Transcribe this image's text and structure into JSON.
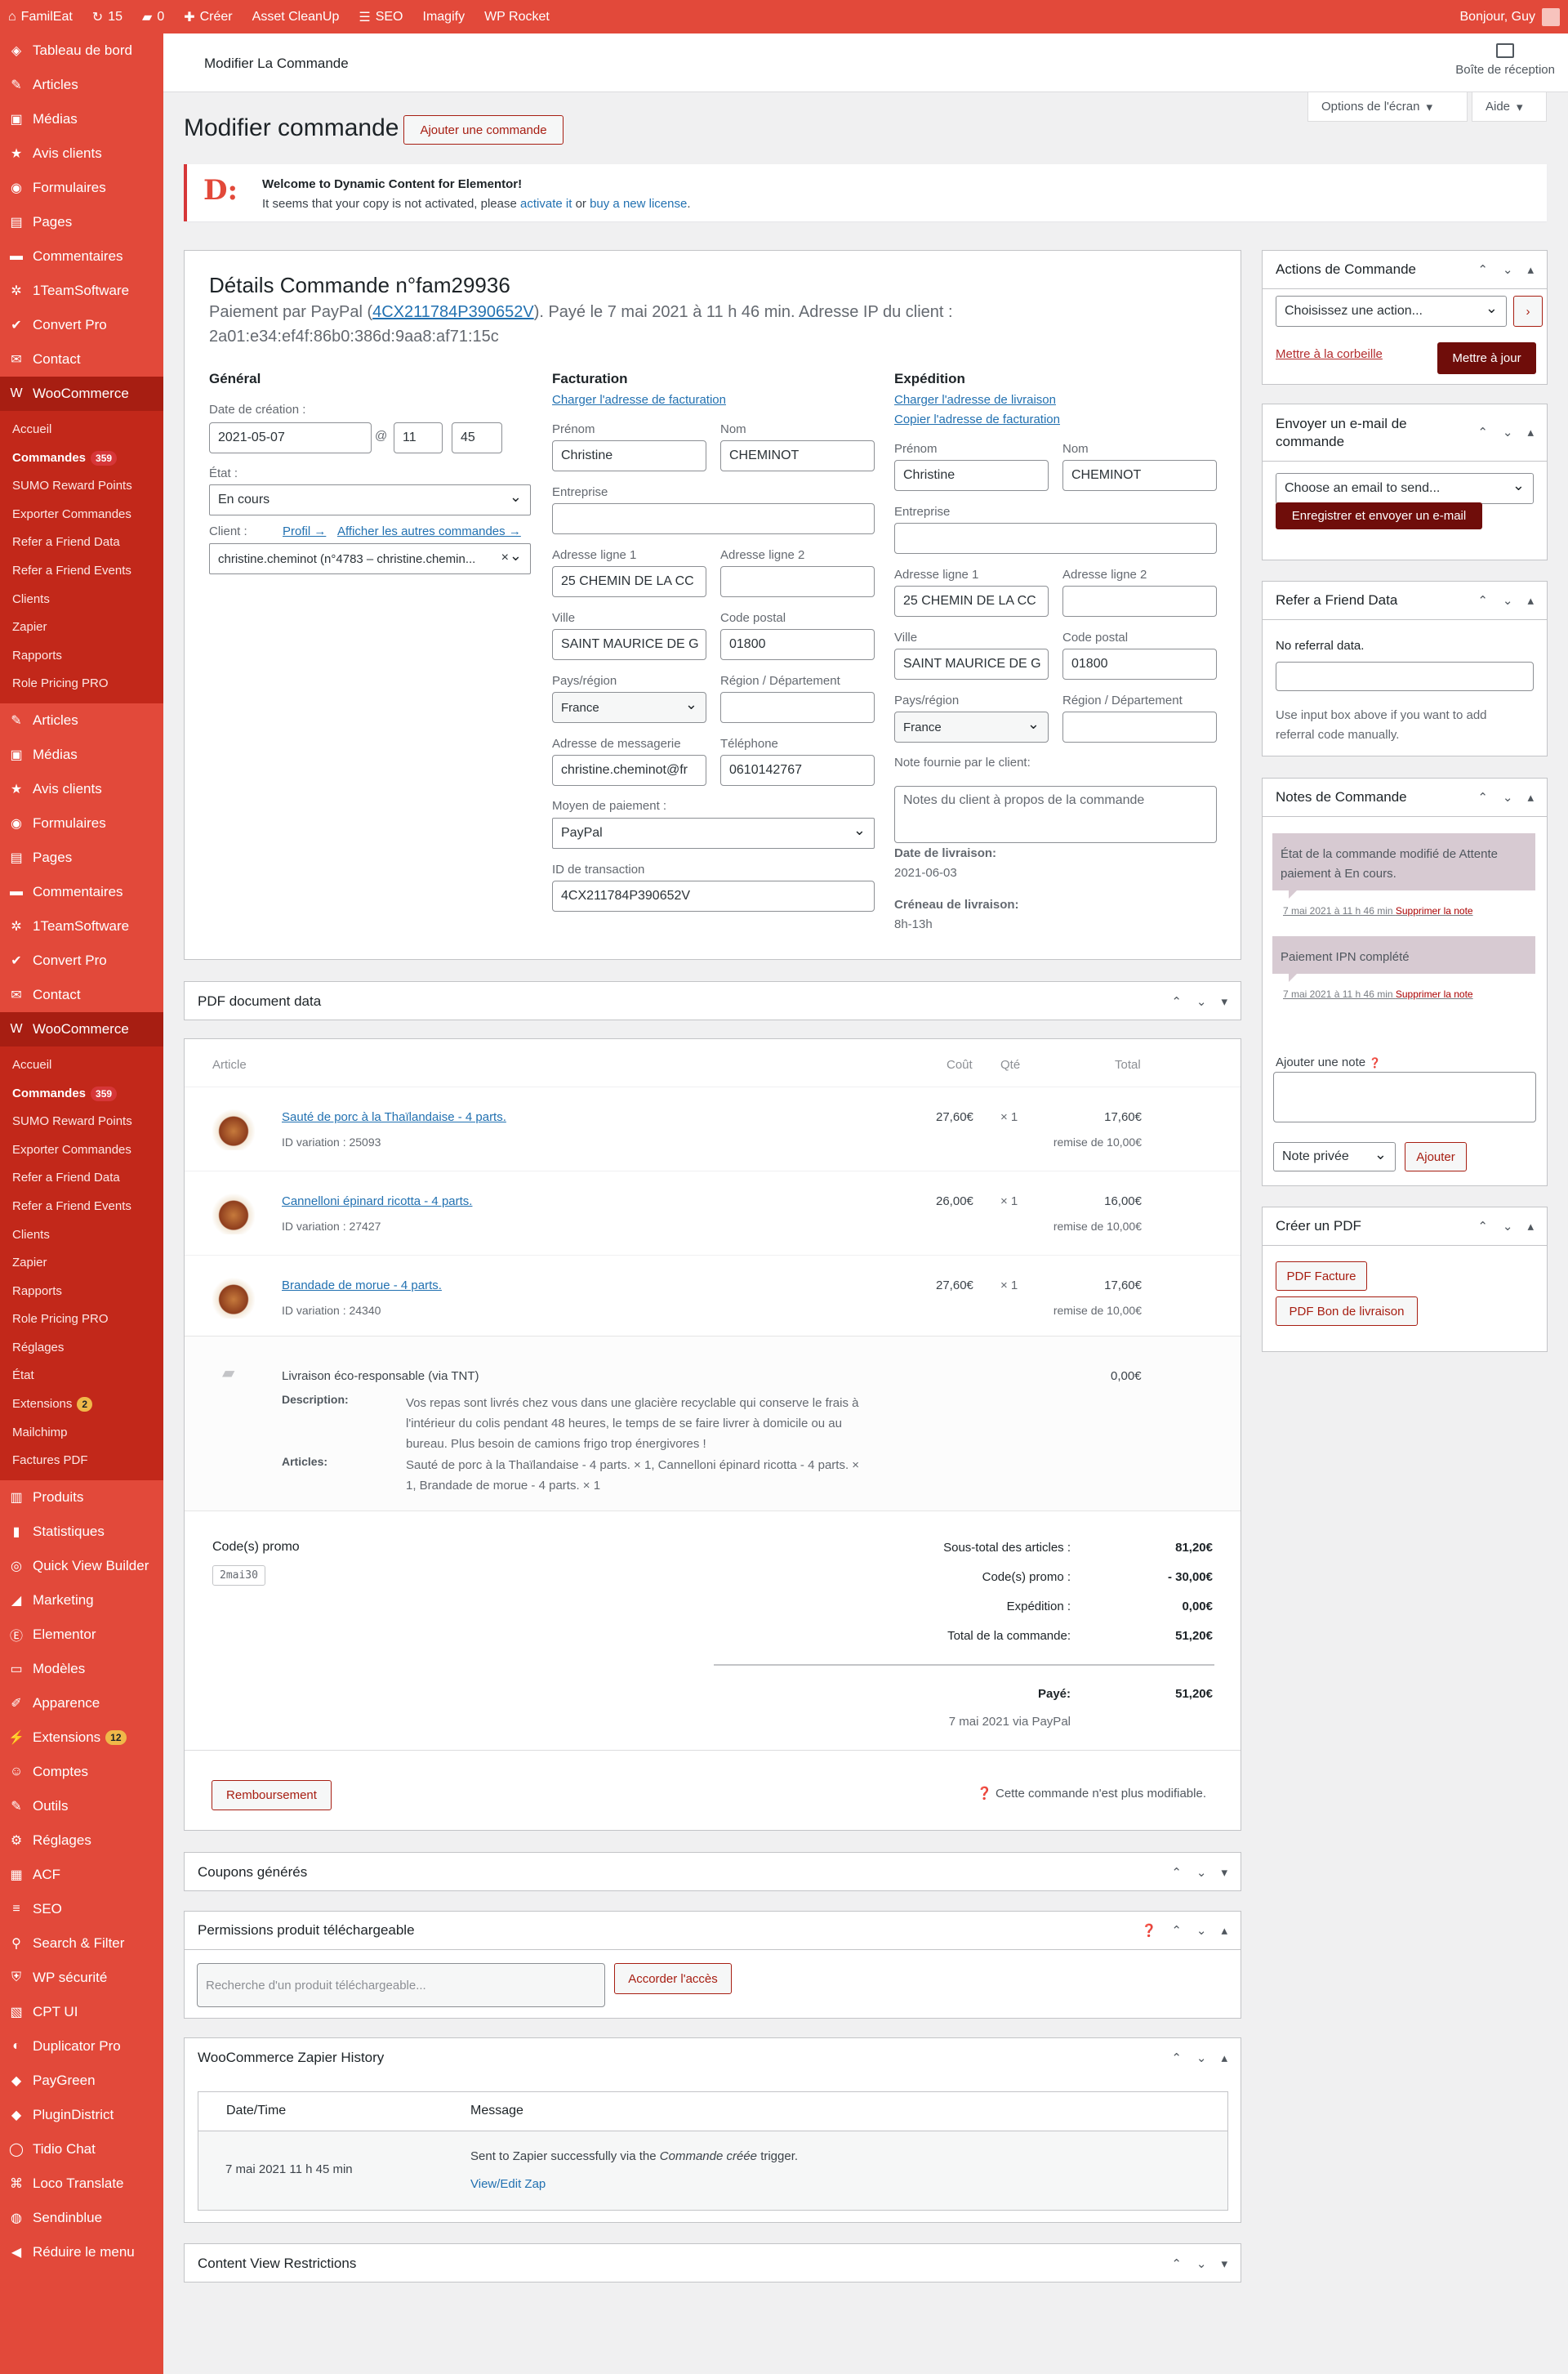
{
  "adminbar": {
    "site": "FamilEat",
    "updates": "15",
    "comments": "0",
    "new": "Créer",
    "asset": "Asset CleanUp",
    "seo": "SEO",
    "imagify": "Imagify",
    "rocket": "WP Rocket",
    "greeting": "Bonjour, Guy"
  },
  "sidebar": {
    "top": [
      {
        "icon": "dashboard-icon",
        "glyph": "◈",
        "label": "Tableau de bord"
      },
      {
        "icon": "pin-icon",
        "glyph": "✎",
        "label": "Articles"
      },
      {
        "icon": "media-icon",
        "glyph": "▣",
        "label": "Médias"
      },
      {
        "icon": "star-icon",
        "glyph": "★",
        "label": "Avis clients"
      },
      {
        "icon": "forms-icon",
        "glyph": "◉",
        "label": "Formulaires"
      },
      {
        "icon": "pages-icon",
        "glyph": "▤",
        "label": "Pages"
      },
      {
        "icon": "comments-icon",
        "glyph": "▬",
        "label": "Commentaires"
      },
      {
        "icon": "gear-icon",
        "glyph": "✲",
        "label": "1TeamSoftware"
      },
      {
        "icon": "check-icon",
        "glyph": "✔",
        "label": "Convert Pro"
      },
      {
        "icon": "mail-icon",
        "glyph": "✉",
        "label": "Contact"
      }
    ],
    "woo_label": "WooCommerce",
    "sub": [
      "Accueil",
      "Commandes",
      "SUMO Reward Points",
      "Exporter Commandes",
      "Refer a Friend Data",
      "Refer a Friend Events",
      "Clients",
      "Zapier",
      "Rapports",
      "Role Pricing PRO"
    ],
    "orders_count": "359",
    "top2": [
      "Articles",
      "Médias",
      "Avis clients",
      "Formulaires",
      "Pages",
      "Commentaires",
      "1TeamSoftware",
      "Convert Pro",
      "Contact"
    ],
    "sub2": [
      "Accueil",
      "Commandes",
      "SUMO Reward Points",
      "Exporter Commandes",
      "Refer a Friend Data",
      "Refer a Friend Events",
      "Clients",
      "Zapier",
      "Rapports",
      "Role Pricing PRO",
      "Réglages",
      "État",
      "Extensions",
      "Mailchimp",
      "Factures PDF"
    ],
    "ext_count": "2",
    "bottom": [
      {
        "icon": "products-icon",
        "glyph": "▥",
        "label": "Produits"
      },
      {
        "icon": "stats-icon",
        "glyph": "▮",
        "label": "Statistiques"
      },
      {
        "icon": "quickview-icon",
        "glyph": "◎",
        "label": "Quick View Builder"
      },
      {
        "icon": "megaphone-icon",
        "glyph": "◢",
        "label": "Marketing"
      },
      {
        "icon": "elementor-icon",
        "glyph": "Ⓔ",
        "label": "Elementor"
      },
      {
        "icon": "folder-icon",
        "glyph": "▭",
        "label": "Modèles"
      },
      {
        "icon": "brush-icon",
        "glyph": "✐",
        "label": "Apparence"
      },
      {
        "icon": "plugin-icon",
        "glyph": "⚡",
        "label": "Extensions"
      },
      {
        "icon": "user-icon",
        "glyph": "☺",
        "label": "Comptes"
      },
      {
        "icon": "wrench-icon",
        "glyph": "✎",
        "label": "Outils"
      },
      {
        "icon": "settings-icon",
        "glyph": "⚙",
        "label": "Réglages"
      },
      {
        "icon": "acf-icon",
        "glyph": "▦",
        "label": "ACF"
      },
      {
        "icon": "seo-icon",
        "glyph": "≡",
        "label": "SEO"
      },
      {
        "icon": "search-icon",
        "glyph": "⚲",
        "label": "Search & Filter"
      },
      {
        "icon": "shield-icon",
        "glyph": "⛨",
        "label": "WP sécurité"
      },
      {
        "icon": "cptui-icon",
        "glyph": "▧",
        "label": "CPT UI"
      },
      {
        "icon": "duplicator-icon",
        "glyph": "◐",
        "label": "Duplicator Pro"
      },
      {
        "icon": "paygreen-icon",
        "glyph": "◆",
        "label": "PayGreen"
      },
      {
        "icon": "plugindistrict-icon",
        "glyph": "◆",
        "label": "PluginDistrict"
      },
      {
        "icon": "chat-icon",
        "glyph": "◯",
        "label": "Tidio Chat"
      },
      {
        "icon": "translate-icon",
        "glyph": "⌘",
        "label": "Loco Translate"
      },
      {
        "icon": "sendinblue-icon",
        "glyph": "◍",
        "label": "Sendinblue"
      },
      {
        "icon": "collapse-icon",
        "glyph": "◀",
        "label": "Réduire le menu"
      }
    ],
    "plugins_count": "12"
  },
  "header": {
    "title": "Modifier La Commande",
    "inbox": "Boîte de réception",
    "screen_options": "Options de l'écran",
    "help": "Aide"
  },
  "page": {
    "title": "Modifier commande",
    "add": "Ajouter une commande"
  },
  "notice": {
    "title": "Welcome to Dynamic Content for Elementor!",
    "text1": "It seems that your copy is not activated, please",
    "activate": "activate it",
    "or": "or",
    "buy": "buy a new license",
    "end": "."
  },
  "order": {
    "title": "Détails Commande n°fam29936",
    "paid_prefix": "Paiement par PayPal (",
    "txn": "4CX211784P390652V",
    "paid_suffix": "). Payé le 7 mai 2021 à 11 h 46 min. Adresse IP du client :",
    "ip": "2a01:e34:ef4f:86b0:386d:9aa8:af71:15c",
    "general": {
      "h": "Général",
      "created_lbl": "Date de création :",
      "date": "2021-05-07",
      "at": "@",
      "hour": "11",
      "minute": "45",
      "state_lbl": "État :",
      "state": "En cours",
      "client_lbl": "Client :",
      "profile": "Profil →",
      "other_orders": "Afficher les autres commandes →",
      "client": "christine.cheminot (n°4783 – christine.chemin..."
    },
    "billing": {
      "h": "Facturation",
      "load": "Charger l'adresse de facturation",
      "first_lbl": "Prénom",
      "first": "Christine",
      "last_lbl": "Nom",
      "last": "CHEMINOT",
      "company_lbl": "Entreprise",
      "a1_lbl": "Adresse ligne 1",
      "a1": "25 CHEMIN DE LA CC",
      "a2_lbl": "Adresse ligne 2",
      "city_lbl": "Ville",
      "city": "SAINT MAURICE DE G",
      "zip_lbl": "Code postal",
      "zip": "01800",
      "country_lbl": "Pays/région",
      "country": "France",
      "region_lbl": "Région / Département",
      "email_lbl": "Adresse de messagerie",
      "email": "christine.cheminot@fr",
      "phone_lbl": "Téléphone",
      "phone": "0610142767",
      "pay_lbl": "Moyen de paiement :",
      "pay": "PayPal",
      "txn_lbl": "ID de transaction",
      "txn": "4CX211784P390652V"
    },
    "shipping": {
      "h": "Expédition",
      "load": "Charger l'adresse de livraison",
      "copy": "Copier l'adresse de facturation",
      "first_lbl": "Prénom",
      "first": "Christine",
      "last_lbl": "Nom",
      "last": "CHEMINOT",
      "company_lbl": "Entreprise",
      "a1_lbl": "Adresse ligne 1",
      "a1": "25 CHEMIN DE LA CC",
      "a2_lbl": "Adresse ligne 2",
      "city_lbl": "Ville",
      "city": "SAINT MAURICE DE G",
      "zip_lbl": "Code postal",
      "zip": "01800",
      "country_lbl": "Pays/région",
      "country": "France",
      "region_lbl": "Région / Département",
      "note_lbl": "Note fournie par le client:",
      "note_ph": "Notes du client à propos de la commande",
      "date_lbl": "Date de livraison:",
      "date": "2021-06-03",
      "slot_lbl": "Créneau de livraison:",
      "slot": "8h-13h"
    }
  },
  "pdfdata": {
    "title": "PDF document data"
  },
  "items": {
    "headers": {
      "article": "Article",
      "cost": "Coût",
      "qty": "Qté",
      "total": "Total"
    },
    "rows": [
      {
        "name": "Sauté de porc à la Thaïlandaise - 4 parts.",
        "var": "ID variation : 25093",
        "cost": "27,60€",
        "qty": "× 1",
        "total": "17,60€",
        "disc": "remise de 10,00€"
      },
      {
        "name": "Cannelloni épinard ricotta - 4 parts.",
        "var": "ID variation : 27427",
        "cost": "26,00€",
        "qty": "× 1",
        "total": "16,00€",
        "disc": "remise de 10,00€"
      },
      {
        "name": "Brandade de morue - 4 parts.",
        "var": "ID variation : 24340",
        "cost": "27,60€",
        "qty": "× 1",
        "total": "17,60€",
        "disc": "remise de 10,00€"
      }
    ],
    "shipping": {
      "name": "Livraison éco-responsable (via TNT)",
      "total": "0,00€",
      "desc_lbl": "Description:",
      "desc": [
        "Vos repas sont livrés chez vous dans une glacière recyclable qui conserve le frais à",
        "l'intérieur du colis pendant 48 heures, le temps de se faire livrer à domicile ou au",
        "bureau. Plus besoin de camions frigo trop énergivores !"
      ],
      "art_lbl": "Articles:",
      "art": [
        "Sauté de porc à la Thaïlandaise - 4 parts. × 1, Cannelloni épinard ricotta - 4 parts. ×",
        "1, Brandade de morue - 4 parts. × 1"
      ]
    },
    "promo_lbl": "Code(s) promo",
    "promo": "2mai30",
    "totals": [
      {
        "l": "Sous-total des articles :",
        "v": "81,20€"
      },
      {
        "l": "Code(s) promo :",
        "v": "- 30,00€"
      },
      {
        "l": "Expédition :",
        "v": "0,00€"
      },
      {
        "l": "Total de la commande:",
        "v": "51,20€"
      }
    ],
    "paid_l": "Payé:",
    "paid_v": "51,20€",
    "paid_via": "7 mai 2021 via PayPal",
    "refund": "Remboursement",
    "locked": "Cette commande n'est plus modifiable."
  },
  "coupons": {
    "title": "Coupons générés"
  },
  "downloads": {
    "title": "Permissions produit téléchargeable",
    "placeholder": "Recherche d'un produit téléchargeable...",
    "grant": "Accorder l'accès"
  },
  "zapier": {
    "title": "WooCommerce Zapier History",
    "h_date": "Date/Time",
    "h_msg": "Message",
    "date": "7 mai 2021 11 h 45 min",
    "msg1": "Sent to Zapier successfully via the",
    "msg_em": "Commande créée",
    "msg2": "trigger.",
    "edit": "View/Edit Zap"
  },
  "cvr": {
    "title": "Content View Restrictions"
  },
  "side": {
    "actions": {
      "title": "Actions de Commande",
      "select": "Choisissez une action...",
      "trash": "Mettre à la corbeille",
      "update": "Mettre à jour"
    },
    "email": {
      "title1": "Envoyer un e-mail de",
      "title2": "commande",
      "select": "Choose an email to send...",
      "send": "Enregistrer et envoyer un e-mail"
    },
    "raf": {
      "title": "Refer a Friend Data",
      "none": "No referral data.",
      "help1": "Use input box above if you want to add",
      "help2": "referral code manually."
    },
    "notes": {
      "title": "Notes de Commande",
      "n1a": "État de la commande modifié de Attente",
      "n1b": "paiement à En cours.",
      "n1meta": "7 mai 2021 à 11 h 46 min",
      "n2": "Paiement IPN complété",
      "n2meta": "7 mai 2021 à 11 h 46 min",
      "del": "Supprimer la note",
      "add_lbl": "Ajouter une note",
      "type": "Note privée",
      "add": "Ajouter"
    },
    "pdf": {
      "title": "Créer un PDF",
      "invoice": "PDF Facture",
      "delivery": "PDF Bon de livraison"
    }
  },
  "colors": {
    "brand": "#e2493a",
    "dark": "#a71e12",
    "submenu": "#c2281a",
    "note": "#d7cad2"
  }
}
